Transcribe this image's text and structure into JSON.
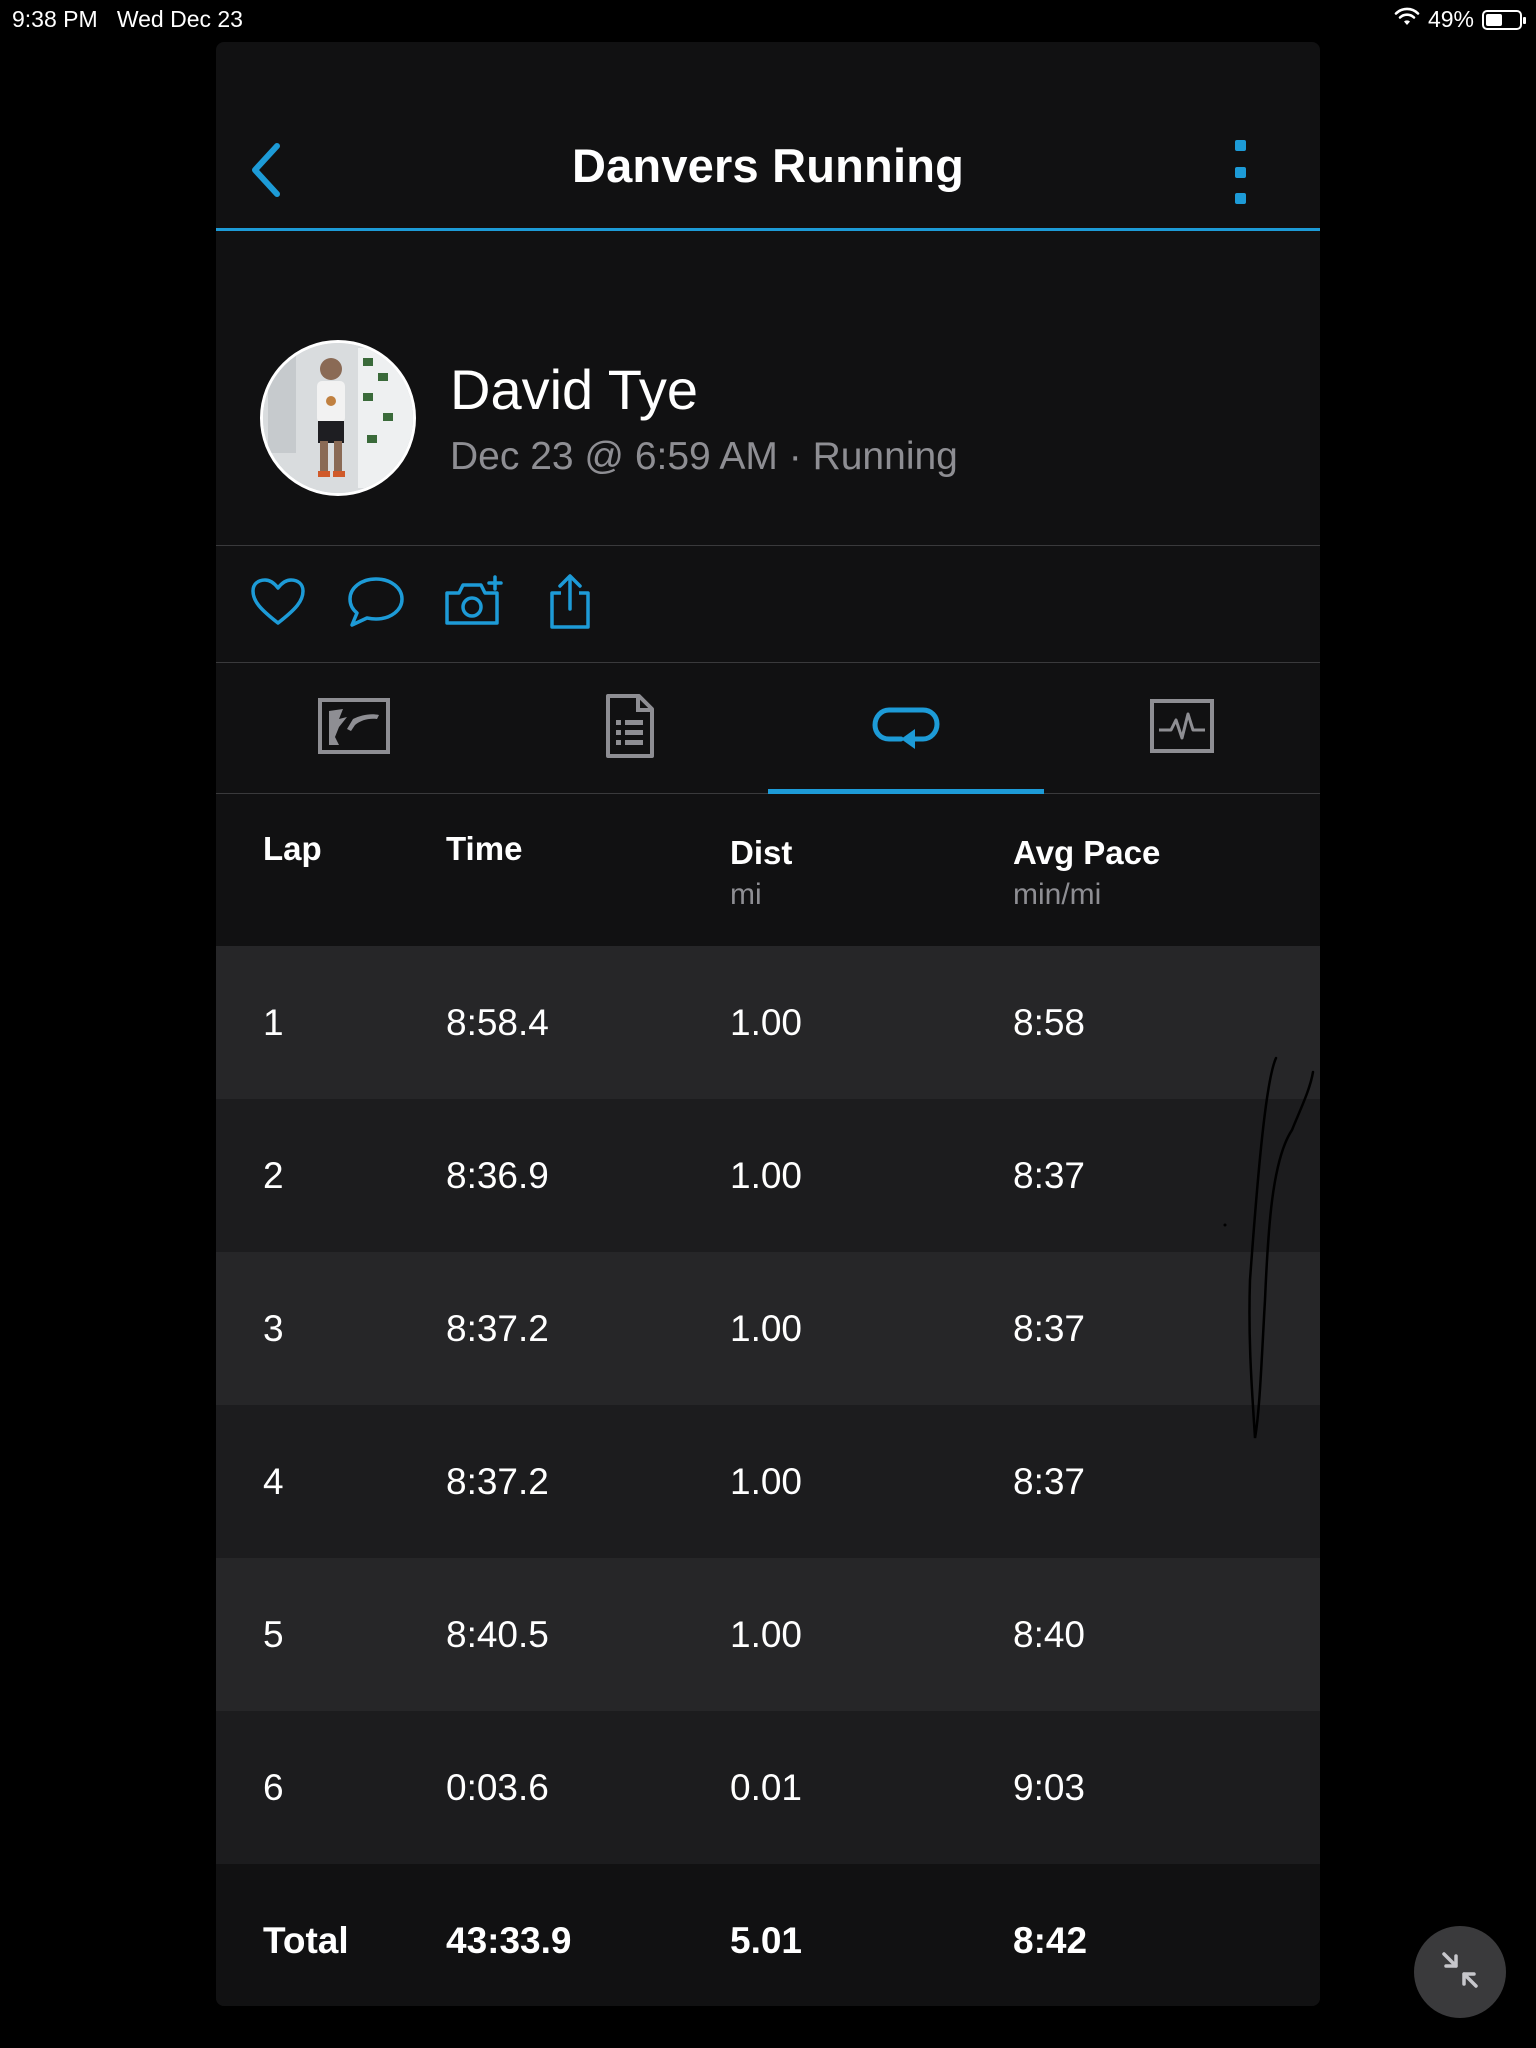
{
  "status_bar": {
    "time": "9:38 PM",
    "date": "Wed Dec 23",
    "battery_percent": "49%",
    "battery_level": 0.49
  },
  "header": {
    "title": "Danvers Running",
    "back_icon": "chevron-left-icon",
    "menu_icon": "more-vertical-icon"
  },
  "profile": {
    "name": "David Tye",
    "meta": "Dec 23 @ 6:59 AM · Running"
  },
  "actions": [
    {
      "name": "like",
      "icon": "heart-icon"
    },
    {
      "name": "comment",
      "icon": "comment-icon"
    },
    {
      "name": "add-photo",
      "icon": "camera-plus-icon"
    },
    {
      "name": "share",
      "icon": "share-icon"
    }
  ],
  "tabs": [
    {
      "name": "map",
      "icon": "map-icon",
      "active": false
    },
    {
      "name": "stats",
      "icon": "document-list-icon",
      "active": false
    },
    {
      "name": "laps",
      "icon": "laps-icon",
      "active": true
    },
    {
      "name": "charts",
      "icon": "chart-icon",
      "active": false
    }
  ],
  "laps_table": {
    "columns": [
      {
        "label": "Lap",
        "unit": ""
      },
      {
        "label": "Time",
        "unit": ""
      },
      {
        "label": "Dist",
        "unit": "mi"
      },
      {
        "label": "Avg Pace",
        "unit": "min/mi"
      }
    ],
    "rows": [
      {
        "lap": "1",
        "time": "8:58.4",
        "dist": "1.00",
        "pace": "8:58"
      },
      {
        "lap": "2",
        "time": "8:36.9",
        "dist": "1.00",
        "pace": "8:37"
      },
      {
        "lap": "3",
        "time": "8:37.2",
        "dist": "1.00",
        "pace": "8:37"
      },
      {
        "lap": "4",
        "time": "8:37.2",
        "dist": "1.00",
        "pace": "8:37"
      },
      {
        "lap": "5",
        "time": "8:40.5",
        "dist": "1.00",
        "pace": "8:40"
      },
      {
        "lap": "6",
        "time": "0:03.6",
        "dist": "0.01",
        "pace": "9:03"
      }
    ],
    "total": {
      "label": "Total",
      "time": "43:33.9",
      "dist": "5.01",
      "pace": "8:42"
    }
  },
  "overlay": {
    "collapse_icon": "collapse-arrows-icon"
  },
  "colors": {
    "accent": "#1d9bd7",
    "background": "#000000",
    "panel": "#111112",
    "row_light": "#262628",
    "row_dark": "#1c1c1e",
    "muted_text": "#8e8e93"
  }
}
